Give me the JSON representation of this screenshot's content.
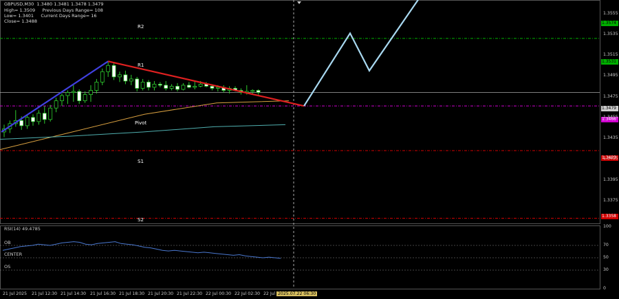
{
  "header": {
    "symbol_line": "GBPUSD,M30  1.3480 1.3481 1.3478 1.3479",
    "high_line": "High= 1.3509     Previous Days Range= 108",
    "low_line": "Low= 1.3401     Current Days Range= 16",
    "close_line": "Close= 1.3488"
  },
  "levels": {
    "r2": {
      "label": "R2",
      "value": 1.3574,
      "tag": "1.3574",
      "color": "#00b000"
    },
    "r1": {
      "label": "R1",
      "value": 1.3531,
      "tag": "1.3531",
      "color": "#00b000"
    },
    "pivot": {
      "label": "Pivot",
      "value": 1.3466,
      "tag": "1.3466",
      "color": "#d000d0"
    },
    "s1": {
      "label": "S1",
      "value": 1.3423,
      "tag": "1.3423",
      "color": "#d00000"
    },
    "s2": {
      "label": "S2",
      "value": 1.3358,
      "tag": "1.3358",
      "color": "#d00000"
    },
    "current": {
      "value": 1.3479,
      "tag": "1.3479"
    }
  },
  "price_axis": [
    1.3555,
    1.3535,
    1.3515,
    1.3495,
    1.3475,
    1.3455,
    1.3435,
    1.3415,
    1.3395,
    1.3375
  ],
  "time_axis": [
    "21 Jul 2025",
    "21 Jul 12:30",
    "21 Jul 14:30",
    "21 Jul 16:30",
    "21 Jul 18:30",
    "21 Jul 20:30",
    "21 Jul 22:30",
    "22 Jul 00:30",
    "22 Jul 02:30",
    "22 Jul",
    "2025.07.22 06:30"
  ],
  "rsi": {
    "title": "RSI(14) 49.4785",
    "ob_label": "OB",
    "center_label": "CENTER",
    "os_label": "OS",
    "axis": [
      100,
      70,
      50,
      30,
      0
    ]
  },
  "chart_data": {
    "type": "candlestick",
    "symbol": "GBPUSD",
    "timeframe": "M30",
    "ylim": [
      1.3353,
      1.3568
    ],
    "candles": [
      {
        "o": 1.3441,
        "h": 1.3448,
        "l": 1.3436,
        "c": 1.3444
      },
      {
        "o": 1.3444,
        "h": 1.3452,
        "l": 1.344,
        "c": 1.3449
      },
      {
        "o": 1.3449,
        "h": 1.3462,
        "l": 1.3446,
        "c": 1.3452
      },
      {
        "o": 1.3452,
        "h": 1.3456,
        "l": 1.3443,
        "c": 1.3447
      },
      {
        "o": 1.3447,
        "h": 1.3458,
        "l": 1.3444,
        "c": 1.3455
      },
      {
        "o": 1.3455,
        "h": 1.3458,
        "l": 1.3447,
        "c": 1.3451
      },
      {
        "o": 1.3451,
        "h": 1.3462,
        "l": 1.3448,
        "c": 1.3459
      },
      {
        "o": 1.3459,
        "h": 1.3466,
        "l": 1.3449,
        "c": 1.3453
      },
      {
        "o": 1.3453,
        "h": 1.3467,
        "l": 1.3451,
        "c": 1.3464
      },
      {
        "o": 1.3464,
        "h": 1.3474,
        "l": 1.346,
        "c": 1.3471
      },
      {
        "o": 1.3471,
        "h": 1.3478,
        "l": 1.3466,
        "c": 1.3476
      },
      {
        "o": 1.3476,
        "h": 1.3481,
        "l": 1.3468,
        "c": 1.3479
      },
      {
        "o": 1.3479,
        "h": 1.3486,
        "l": 1.347,
        "c": 1.348
      },
      {
        "o": 1.348,
        "h": 1.3482,
        "l": 1.3468,
        "c": 1.3471
      },
      {
        "o": 1.3471,
        "h": 1.348,
        "l": 1.3469,
        "c": 1.3477
      },
      {
        "o": 1.3477,
        "h": 1.3486,
        "l": 1.347,
        "c": 1.3481
      },
      {
        "o": 1.3481,
        "h": 1.3492,
        "l": 1.3478,
        "c": 1.3489
      },
      {
        "o": 1.3489,
        "h": 1.3502,
        "l": 1.3486,
        "c": 1.3499
      },
      {
        "o": 1.3499,
        "h": 1.3509,
        "l": 1.3494,
        "c": 1.3505
      },
      {
        "o": 1.3505,
        "h": 1.3508,
        "l": 1.3491,
        "c": 1.3494
      },
      {
        "o": 1.3494,
        "h": 1.3499,
        "l": 1.3489,
        "c": 1.3496
      },
      {
        "o": 1.3496,
        "h": 1.35,
        "l": 1.3487,
        "c": 1.349
      },
      {
        "o": 1.349,
        "h": 1.3496,
        "l": 1.3486,
        "c": 1.3492
      },
      {
        "o": 1.3492,
        "h": 1.3494,
        "l": 1.348,
        "c": 1.3483
      },
      {
        "o": 1.3483,
        "h": 1.3492,
        "l": 1.3481,
        "c": 1.3489
      },
      {
        "o": 1.3489,
        "h": 1.3491,
        "l": 1.3481,
        "c": 1.3484
      },
      {
        "o": 1.3484,
        "h": 1.349,
        "l": 1.3481,
        "c": 1.3487
      },
      {
        "o": 1.3487,
        "h": 1.3489,
        "l": 1.3484,
        "c": 1.3486
      },
      {
        "o": 1.3486,
        "h": 1.349,
        "l": 1.3481,
        "c": 1.3483
      },
      {
        "o": 1.3483,
        "h": 1.3487,
        "l": 1.3481,
        "c": 1.3485
      },
      {
        "o": 1.3485,
        "h": 1.3488,
        "l": 1.348,
        "c": 1.3482
      },
      {
        "o": 1.3482,
        "h": 1.3488,
        "l": 1.3481,
        "c": 1.3486
      },
      {
        "o": 1.3486,
        "h": 1.3489,
        "l": 1.3483,
        "c": 1.3484
      },
      {
        "o": 1.3484,
        "h": 1.349,
        "l": 1.3482,
        "c": 1.3485
      },
      {
        "o": 1.3485,
        "h": 1.349,
        "l": 1.3484,
        "c": 1.3487
      },
      {
        "o": 1.3487,
        "h": 1.3489,
        "l": 1.3484,
        "c": 1.3485
      },
      {
        "o": 1.3485,
        "h": 1.3487,
        "l": 1.3481,
        "c": 1.3483
      },
      {
        "o": 1.3483,
        "h": 1.3486,
        "l": 1.348,
        "c": 1.3484
      },
      {
        "o": 1.3484,
        "h": 1.3486,
        "l": 1.3479,
        "c": 1.3481
      },
      {
        "o": 1.3481,
        "h": 1.3485,
        "l": 1.3478,
        "c": 1.3483
      },
      {
        "o": 1.3483,
        "h": 1.3485,
        "l": 1.348,
        "c": 1.3481
      },
      {
        "o": 1.3481,
        "h": 1.3483,
        "l": 1.3477,
        "c": 1.3479
      },
      {
        "o": 1.3479,
        "h": 1.3486,
        "l": 1.3477,
        "c": 1.348
      },
      {
        "o": 1.348,
        "h": 1.3482,
        "l": 1.3478,
        "c": 1.3481
      },
      {
        "o": 1.3481,
        "h": 1.3482,
        "l": 1.3477,
        "c": 1.3479
      }
    ],
    "ma_slow": [
      1.3424,
      1.3441,
      1.3458,
      1.3469,
      1.3471
    ],
    "ma_fast": [
      1.3434,
      1.3437,
      1.3441,
      1.3446,
      1.3448
    ],
    "trend_up": {
      "from_index": 0,
      "from": 1.3441,
      "to_index": 18,
      "to": 1.3509,
      "color": "#4040e0"
    },
    "trend_down": {
      "from_index": 18,
      "from": 1.3509,
      "to": 1.3466,
      "color": "#e02020"
    },
    "projection": [
      1.3466,
      1.3536,
      1.35,
      1.3574
    ],
    "projection_color": "#a8d8f0",
    "rsi_values": [
      62,
      64,
      66,
      68,
      69,
      70,
      72,
      71,
      70,
      72,
      74,
      75,
      76,
      75,
      72,
      71,
      73,
      74,
      75,
      76,
      73,
      72,
      71,
      69,
      67,
      66,
      64,
      62,
      61,
      62,
      61,
      60,
      59,
      58,
      59,
      58,
      57,
      56,
      55,
      54,
      55,
      53,
      52,
      51,
      50,
      51,
      50,
      49
    ],
    "rsi_ylim": [
      0,
      100
    ]
  }
}
